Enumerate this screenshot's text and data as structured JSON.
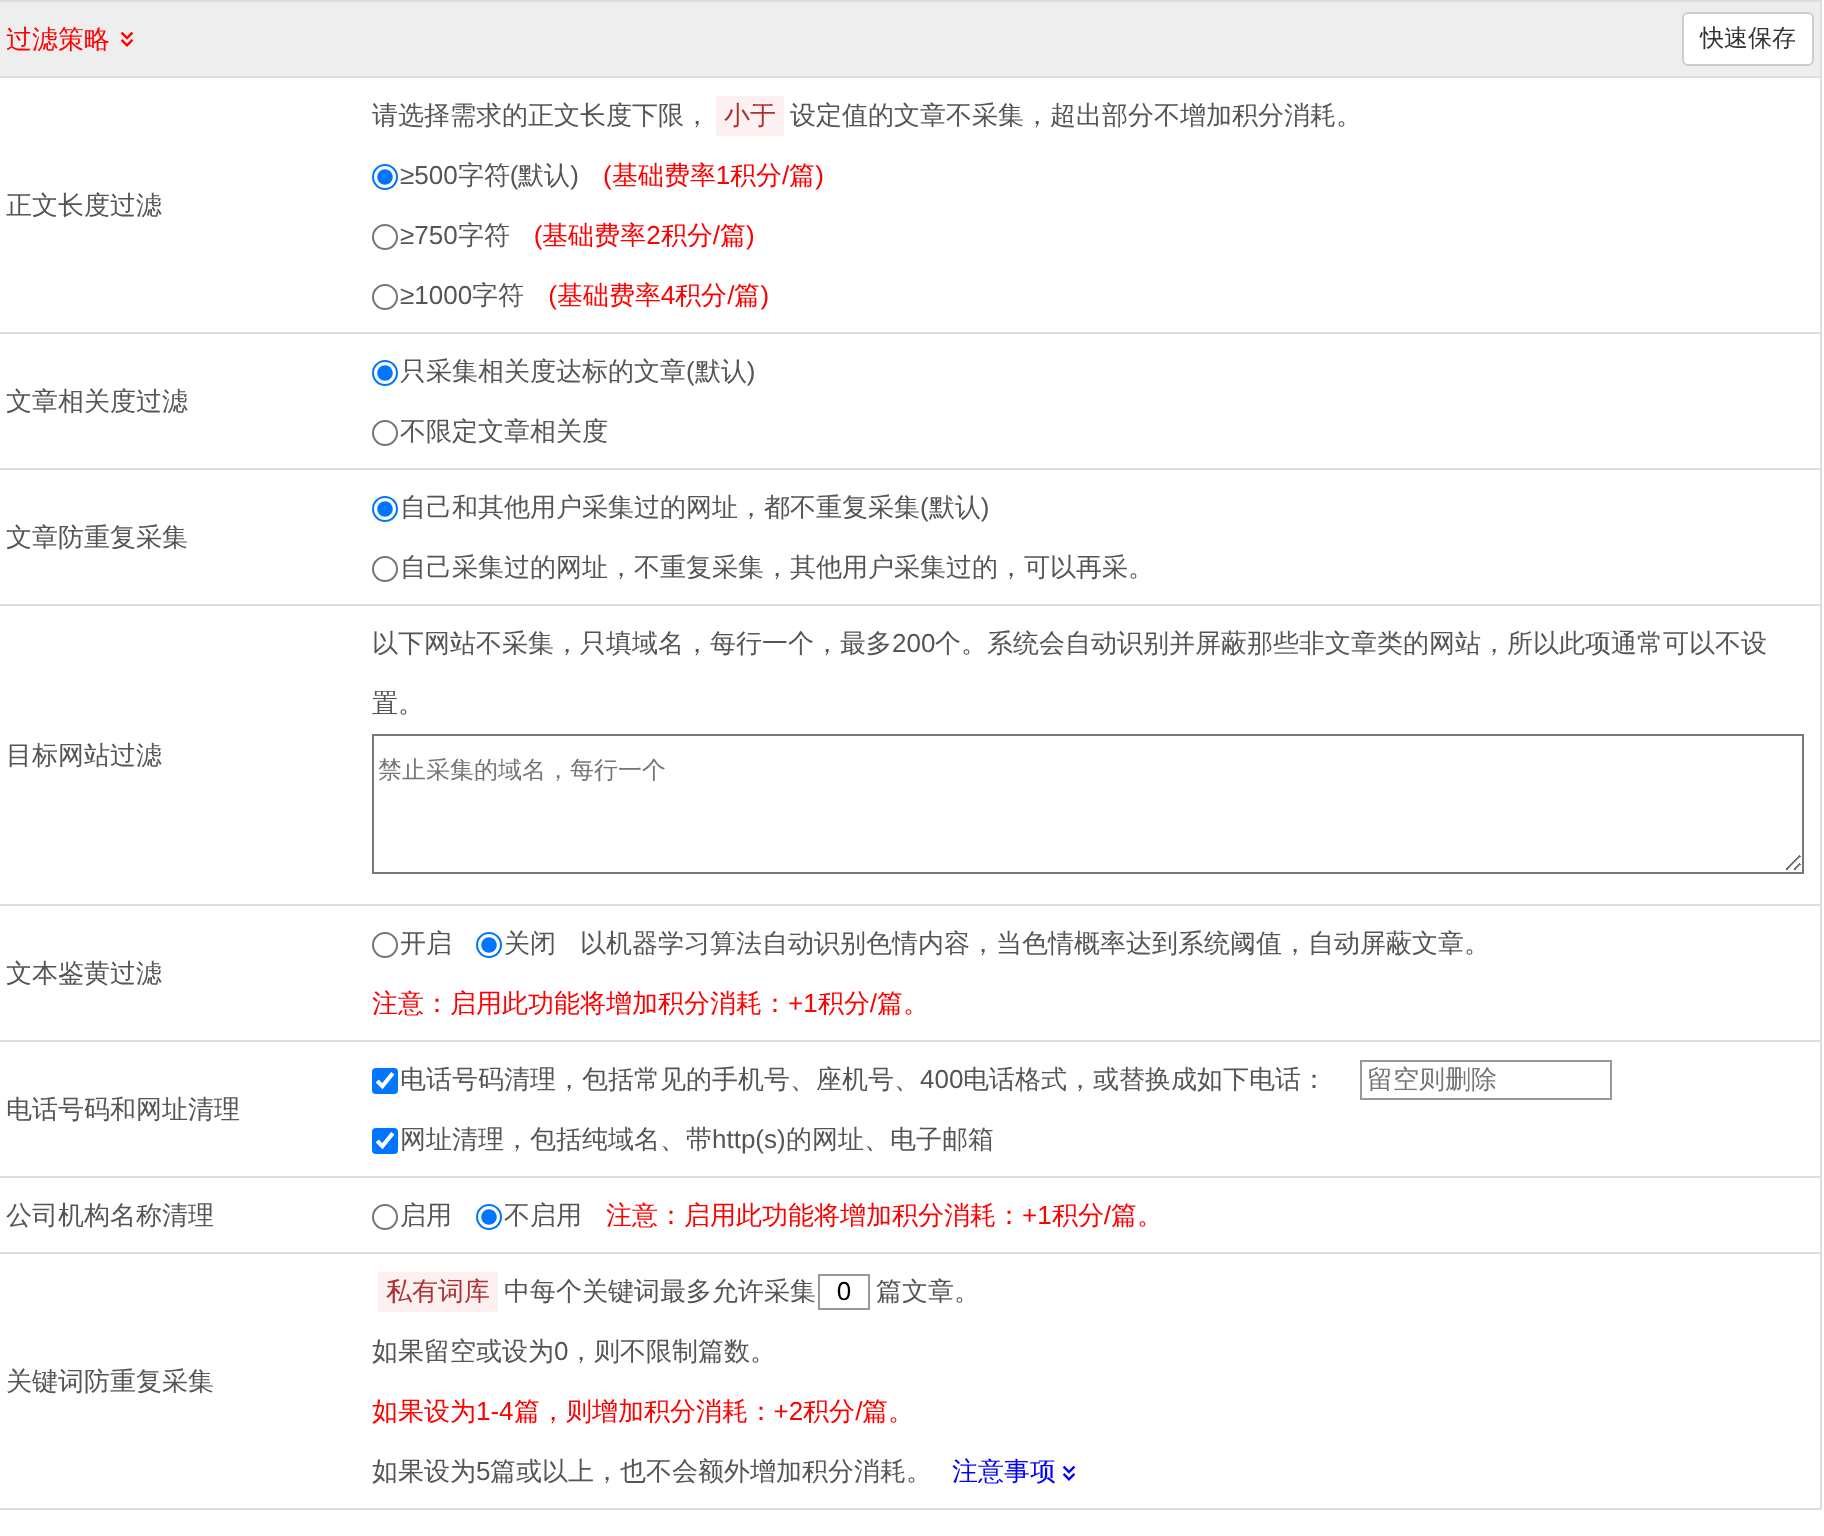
{
  "header": {
    "title": "过滤策略",
    "save_button": "快速保存"
  },
  "rows": [
    {
      "label": "正文长度过滤",
      "lines": [
        [
          {
            "kind": "text",
            "text": "请选择需求的正文长度下限，"
          },
          {
            "kind": "tag",
            "text": "小于"
          },
          {
            "kind": "text",
            "text": "设定值的文章不采集，超出部分不增加积分消耗。"
          }
        ],
        [
          {
            "kind": "radio",
            "label": "≥500字符(默认)",
            "selected": true
          },
          {
            "kind": "red",
            "text": "(基础费率1积分/篇)"
          }
        ],
        [
          {
            "kind": "radio",
            "label": "≥750字符",
            "selected": false
          },
          {
            "kind": "red",
            "text": "(基础费率2积分/篇)"
          }
        ],
        [
          {
            "kind": "radio",
            "label": "≥1000字符",
            "selected": false
          },
          {
            "kind": "red",
            "text": "(基础费率4积分/篇)"
          }
        ]
      ]
    },
    {
      "label": "文章相关度过滤",
      "lines": [
        [
          {
            "kind": "radio",
            "label": "只采集相关度达标的文章(默认)",
            "selected": true
          }
        ],
        [
          {
            "kind": "radio",
            "label": "不限定文章相关度",
            "selected": false
          }
        ]
      ]
    },
    {
      "label": "文章防重复采集",
      "lines": [
        [
          {
            "kind": "radio",
            "label": "自己和其他用户采集过的网址，都不重复采集(默认)",
            "selected": true
          }
        ],
        [
          {
            "kind": "radio",
            "label": "自己采集过的网址，不重复采集，其他用户采集过的，可以再采。",
            "selected": false
          }
        ]
      ]
    },
    {
      "label": "目标网站过滤",
      "lines": [
        [
          {
            "kind": "text",
            "text": "以下网站不采集，只填域名，每行一个，最多200个。系统会自动识别并屏蔽那些非文章类的网站，所以此项通常可以不设置。"
          }
        ],
        [
          {
            "kind": "textarea",
            "placeholder": "禁止采集的域名，每行一个"
          }
        ]
      ]
    },
    {
      "label": "文本鉴黄过滤",
      "lines": [
        [
          {
            "kind": "radio",
            "label": "开启",
            "selected": false
          },
          {
            "kind": "radio",
            "label": "关闭",
            "selected": true
          },
          {
            "kind": "text",
            "text": "以机器学习算法自动识别色情内容，当色情概率达到系统阈值，自动屏蔽文章。"
          }
        ],
        [
          {
            "kind": "red",
            "text": "注意：启用此功能将增加积分消耗：+1积分/篇。"
          }
        ]
      ]
    },
    {
      "label": "电话号码和网址清理",
      "lines": [
        [
          {
            "kind": "checkbox",
            "label": "电话号码清理，包括常见的手机号、座机号、400电话格式，或替换成如下电话：",
            "checked": true
          },
          {
            "kind": "input",
            "placeholder": "留空则删除"
          }
        ],
        [
          {
            "kind": "checkbox",
            "label": "网址清理，包括纯域名、带http(s)的网址、电子邮箱",
            "checked": true
          }
        ]
      ]
    },
    {
      "label": "公司机构名称清理",
      "lines": [
        [
          {
            "kind": "radio",
            "label": "启用",
            "selected": false
          },
          {
            "kind": "radio",
            "label": "不启用",
            "selected": true
          },
          {
            "kind": "red",
            "text": "注意：启用此功能将增加积分消耗：+1积分/篇。"
          }
        ]
      ]
    },
    {
      "label": "关键词防重复采集",
      "lines": [
        [
          {
            "kind": "tag",
            "text": "私有词库"
          },
          {
            "kind": "text",
            "text": "中每个关键词最多允许采集"
          },
          {
            "kind": "number",
            "value": "0"
          },
          {
            "kind": "text",
            "text": "篇文章。"
          }
        ],
        [
          {
            "kind": "text",
            "text": "如果留空或设为0，则不限制篇数。"
          }
        ],
        [
          {
            "kind": "red",
            "text": "如果设为1-4篇，则增加积分消耗：+2积分/篇。"
          }
        ],
        [
          {
            "kind": "text",
            "text": "如果设为5篇或以上，也不会额外增加积分消耗。"
          },
          {
            "kind": "link",
            "text": "注意事项"
          }
        ]
      ]
    }
  ]
}
